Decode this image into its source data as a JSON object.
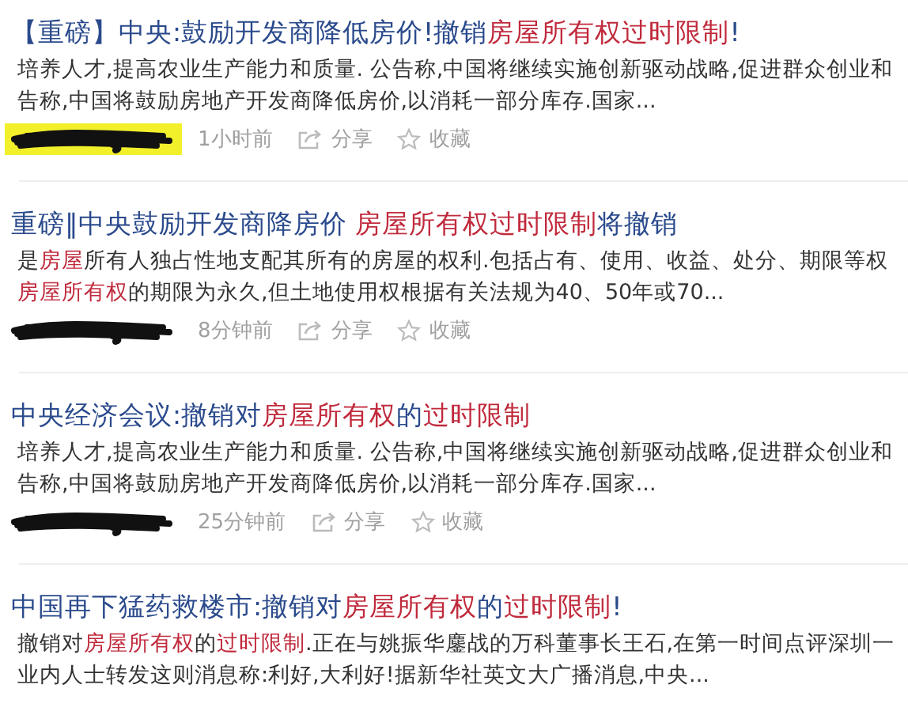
{
  "results": [
    {
      "title": [
        {
          "text": "【重磅】中央:鼓励开发商降低房价!撤销",
          "highlight": false
        },
        {
          "text": "房屋所有权过时限制",
          "highlight": true
        },
        {
          "text": "!",
          "highlight": false
        }
      ],
      "snippet": [
        [
          {
            "text": "培养人才,提高农业生产能力和质量. 公告称,中国将继续实施创新驱动战略,促进群众创业和",
            "highlight": false
          }
        ],
        [
          {
            "text": "告称,中国将鼓励房地产开发商降低房价,以消耗一部分库存.国家...",
            "highlight": false
          }
        ]
      ],
      "meta": {
        "scribble_highlighted": true,
        "time": "1小时前",
        "share": "分享",
        "favorite": "收藏"
      }
    },
    {
      "title": [
        {
          "text": "重磅‖中央鼓励开发商降房价 ",
          "highlight": false
        },
        {
          "text": "房屋所有权过时限制",
          "highlight": true
        },
        {
          "text": "将撤销",
          "highlight": false
        }
      ],
      "snippet": [
        [
          {
            "text": "是",
            "highlight": false
          },
          {
            "text": "房屋",
            "highlight": true
          },
          {
            "text": "所有人独占性地支配其所有的房屋的权利.包括占有、使用、收益、处分、期限等权",
            "highlight": false
          }
        ],
        [
          {
            "text": "房屋所有权",
            "highlight": true
          },
          {
            "text": "的期限为永久,但土地使用权根据有关法规为40、50年或70...",
            "highlight": false
          }
        ]
      ],
      "meta": {
        "scribble_highlighted": false,
        "time": "8分钟前",
        "share": "分享",
        "favorite": "收藏"
      }
    },
    {
      "title": [
        {
          "text": "中央经济会议:撤销对",
          "highlight": false
        },
        {
          "text": "房屋所有权",
          "highlight": true
        },
        {
          "text": "的",
          "highlight": false
        },
        {
          "text": "过时限制",
          "highlight": true
        }
      ],
      "snippet": [
        [
          {
            "text": "培养人才,提高农业生产能力和质量. 公告称,中国将继续实施创新驱动战略,促进群众创业和",
            "highlight": false
          }
        ],
        [
          {
            "text": "告称,中国将鼓励房地产开发商降低房价,以消耗一部分库存.国家...",
            "highlight": false
          }
        ]
      ],
      "meta": {
        "scribble_highlighted": false,
        "time": "25分钟前",
        "share": "分享",
        "favorite": "收藏"
      }
    },
    {
      "title": [
        {
          "text": "中国再下猛药救楼市:撤销对",
          "highlight": false
        },
        {
          "text": "房屋所有权",
          "highlight": true
        },
        {
          "text": "的",
          "highlight": false
        },
        {
          "text": "过时限制",
          "highlight": true
        },
        {
          "text": "!",
          "highlight": false
        }
      ],
      "snippet": [
        [
          {
            "text": "撤销对",
            "highlight": false
          },
          {
            "text": "房屋所有权",
            "highlight": true
          },
          {
            "text": "的",
            "highlight": false
          },
          {
            "text": "过时限制",
            "highlight": true
          },
          {
            "text": ".正在与姚振华鏖战的万科董事长王石,在第一时间点评深圳一",
            "highlight": false
          }
        ],
        [
          {
            "text": "业内人士转发这则消息称:利好,大利好!据新华社英文大广播消息,中央...",
            "highlight": false
          }
        ]
      ]
    }
  ]
}
